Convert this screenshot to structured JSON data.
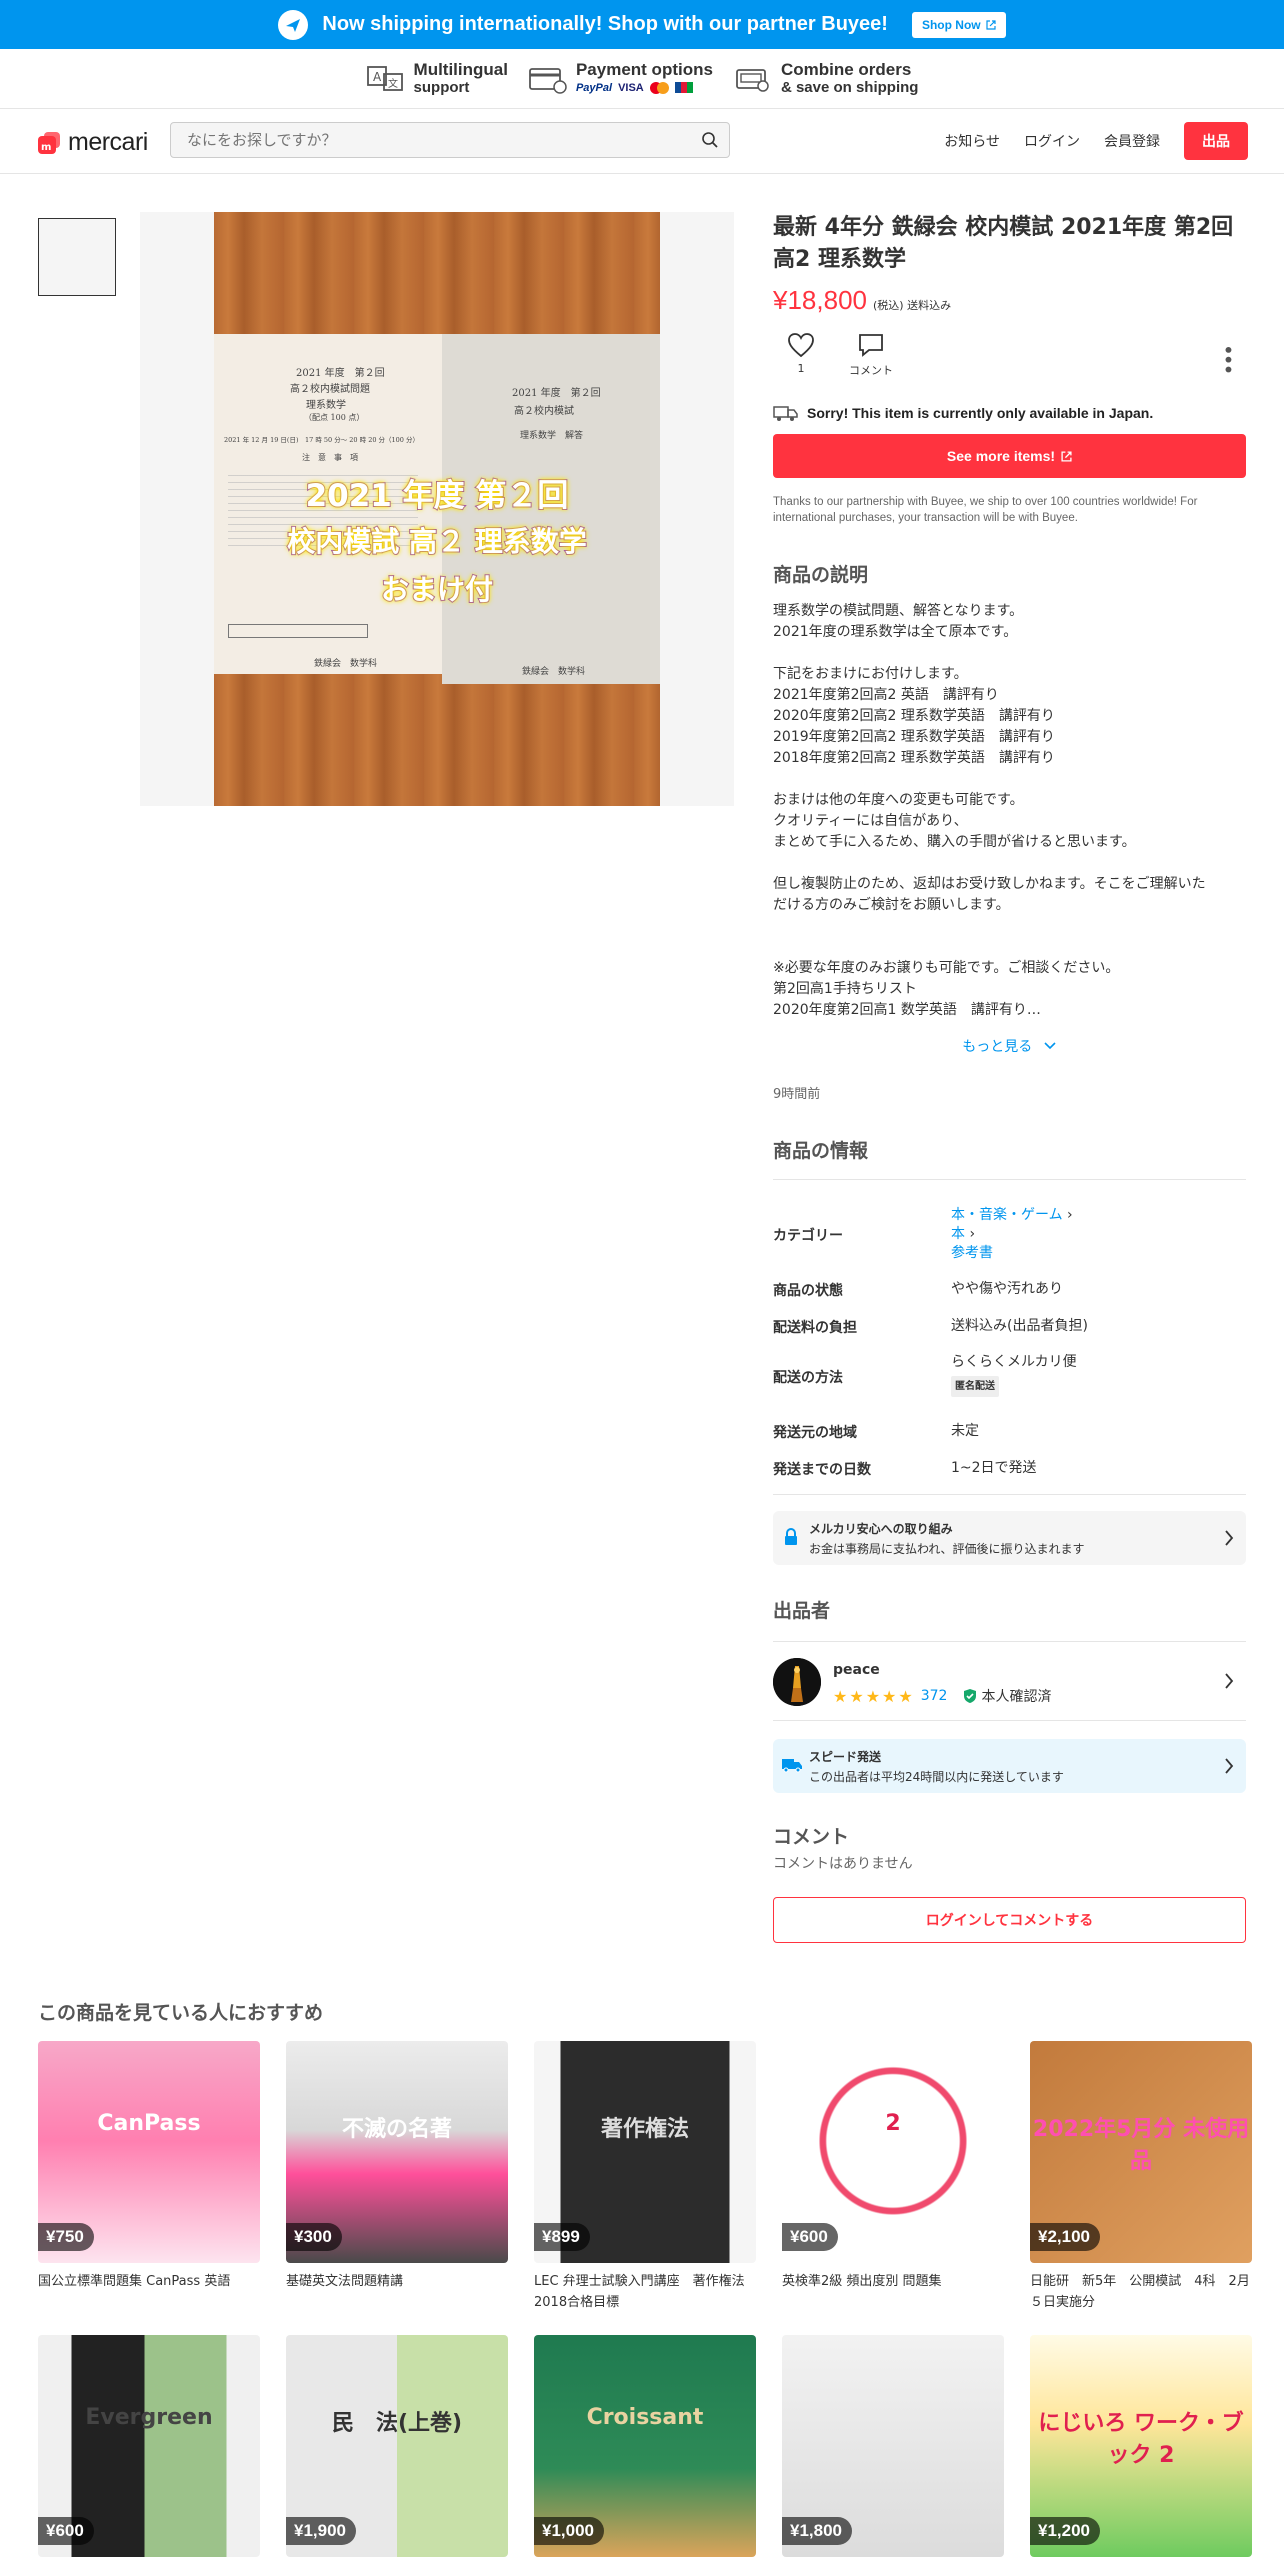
{
  "banner": {
    "text": "Now shipping internationally! Shop with our partner Buyee!",
    "button": "Shop Now"
  },
  "features": [
    {
      "title": "Multilingual",
      "sub": "support"
    },
    {
      "title": "Payment options",
      "sub": ""
    },
    {
      "title": "Combine orders",
      "sub": "& save on shipping"
    }
  ],
  "payment_logos": {
    "paypal": "PayPal",
    "visa": "VISA"
  },
  "header": {
    "logo": "mercari",
    "search_placeholder": "なにをお探しですか？",
    "nav": {
      "news": "お知らせ",
      "login": "ログイン",
      "signup": "会員登録",
      "sell": "出品"
    }
  },
  "photo": {
    "paper_left": [
      "2021 年度　第２回",
      "高２校内模試問題",
      "理系数学",
      "（配点 100 点）",
      "2021 年 12 月 19 日(日)　17 時 50 分〜 20 時 20 分（100 分）",
      "注　意　事　項",
      "鉄緑会　数学科"
    ],
    "paper_right": [
      "2021 年度　第２回",
      "高２校内模試",
      "理系数学　解答",
      "鉄緑会　数学科"
    ],
    "overlay": [
      "2021 年度 第２回",
      "校内模試 高２ 理系数学",
      "おまけ付"
    ]
  },
  "item": {
    "title": "最新 4年分 鉄緑会 校内模試 2021年度 第2回 高2 理系数学",
    "price": "¥18,800",
    "price_note": "(税込) 送料込み",
    "likes": "1",
    "comment_label": "コメント",
    "japan_only": "Sorry! This item is currently only available in Japan.",
    "see_more": "See more items!",
    "partner_note": "Thanks to our partnership with Buyee, we ship to over 100 countries worldwide! For international purchases, your transaction will be with Buyee."
  },
  "description": {
    "heading": "商品の説明",
    "lines": [
      "理系数学の模試問題、解答となります。",
      "2021年度の理系数学は全て原本です。",
      "",
      "下記をおまけにお付けします。",
      "2021年度第2回高2 英語　講評有り",
      "2020年度第2回高2 理系数学英語　講評有り",
      "2019年度第2回高2 理系数学英語　講評有り",
      "2018年度第2回高2 理系数学英語　講評有り",
      "",
      "おまけは他の年度への変更も可能です。",
      "クオリティーには自信があり、",
      "まとめて手に入るため、購入の手間が省けると思います。",
      "",
      "但し複製防止のため、返却はお受け致しかねます。そこをご理解いた",
      "だける方のみご検討をお願いします。",
      "",
      "",
      "※必要な年度のみお譲りも可能です。ご相談ください。",
      "第2回高1手持ちリスト",
      "2020年度第2回高1 数学英語　講評有り…"
    ],
    "read_more": "もっと見る",
    "posted": "9時間前"
  },
  "info": {
    "heading": "商品の情報",
    "category_label": "カテゴリー",
    "category": [
      "本・音楽・ゲーム",
      "本",
      "参考書"
    ],
    "condition_label": "商品の状態",
    "condition": "やや傷や汚れあり",
    "shipping_fee_label": "配送料の負担",
    "shipping_fee": "送料込み(出品者負担)",
    "shipping_method_label": "配送の方法",
    "shipping_method": "らくらくメルカリ便",
    "anonymous": "匿名配送",
    "ship_from_label": "発送元の地域",
    "ship_from": "未定",
    "days_label": "発送までの日数",
    "days": "1~2日で発送"
  },
  "safe": {
    "title": "メルカリ安心への取り組み",
    "sub": "お金は事務局に支払われ、評価後に振り込まれます"
  },
  "seller": {
    "heading": "出品者",
    "name": "peace",
    "rating_count": "372",
    "rating": 5,
    "verified": "本人確認済"
  },
  "speed": {
    "title": "スピード発送",
    "sub": "この出品者は平均24時間以内に発送しています"
  },
  "comments": {
    "heading": "コメント",
    "empty": "コメントはありません",
    "login_button": "ログインしてコメントする"
  },
  "recommend": {
    "heading": "この商品を見ている人におすすめ",
    "items": [
      {
        "price": "¥750",
        "name": "国公立標準問題集 CanPass 英語",
        "cover_text": "CanPass"
      },
      {
        "price": "¥300",
        "name": "基礎英文法問題精講",
        "cover_text": "不滅の名著"
      },
      {
        "price": "¥899",
        "name": "LEC 弁理士試験入門講座　著作権法　2018合格目標",
        "cover_text": "著作権法"
      },
      {
        "price": "¥600",
        "name": "英検準2級 頻出度別 問題集",
        "cover_text": "2"
      },
      {
        "price": "¥2,100",
        "name": "日能研　新5年　公開模試　4科　2月５日実施分",
        "cover_text": "2022年5月分 未使用品"
      },
      {
        "price": "¥600",
        "name": "",
        "cover_text": "Evergreen"
      },
      {
        "price": "¥1,900",
        "name": "",
        "cover_text": "民　法(上巻)"
      },
      {
        "price": "¥1,000",
        "name": "",
        "cover_text": "Croissant"
      },
      {
        "price": "¥1,800",
        "name": "",
        "cover_text": ""
      },
      {
        "price": "¥1,200",
        "name": "",
        "cover_text": "にじいろ ワーク・ブック 2"
      }
    ]
  },
  "colors": {
    "accent": "#ff333f",
    "link": "#0095ee",
    "banner": "#0095ee"
  }
}
